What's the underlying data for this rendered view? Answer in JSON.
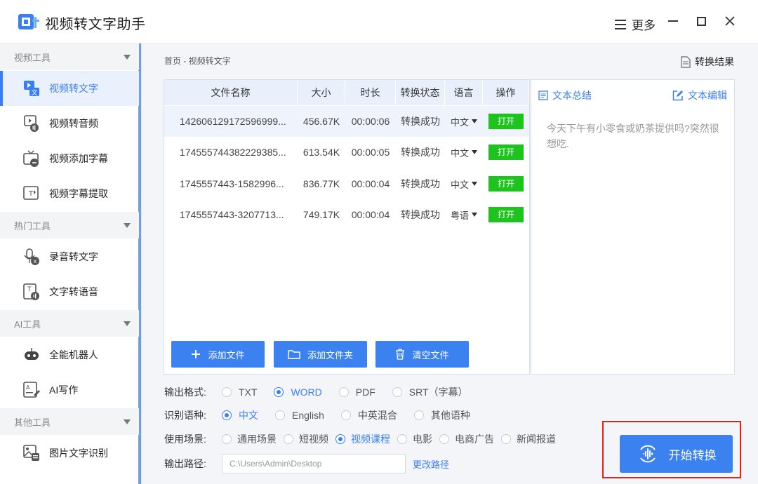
{
  "app": {
    "title": "视频转文字助手",
    "more_label": "更多"
  },
  "colors": {
    "accent": "#3b82f0",
    "success": "#1ec41e",
    "highlight": "#e0241b"
  },
  "sidebar": {
    "groups": [
      {
        "label": "视频工具",
        "items": [
          {
            "label": "视频转文字",
            "icon": "video-to-text-icon",
            "active": true
          },
          {
            "label": "视频转音频",
            "icon": "video-to-audio-icon"
          },
          {
            "label": "视频添加字幕",
            "icon": "add-subtitle-icon"
          },
          {
            "label": "视频字幕提取",
            "icon": "extract-subtitle-icon"
          }
        ]
      },
      {
        "label": "热门工具",
        "items": [
          {
            "label": "录音转文字",
            "icon": "microphone-icon"
          },
          {
            "label": "文字转语音",
            "icon": "text-to-speech-icon"
          }
        ]
      },
      {
        "label": "AI工具",
        "items": [
          {
            "label": "全能机器人",
            "icon": "robot-icon"
          },
          {
            "label": "AI写作",
            "icon": "ai-writing-icon"
          }
        ]
      },
      {
        "label": "其他工具",
        "items": [
          {
            "label": "图片文字识别",
            "icon": "image-ocr-icon"
          }
        ]
      }
    ]
  },
  "breadcrumb": "首页 - 视频转文字",
  "result_link": "转换结果",
  "table": {
    "headers": [
      "文件名称",
      "大小",
      "时长",
      "转换状态",
      "语言",
      "操作"
    ],
    "rows": [
      {
        "name": "142606129172596999...",
        "size": "456.67K",
        "duration": "00:00:06",
        "status": "转换成功",
        "lang": "中文",
        "action": "打开"
      },
      {
        "name": "174555744382229385...",
        "size": "613.54K",
        "duration": "00:00:05",
        "status": "转换成功",
        "lang": "中文",
        "action": "打开"
      },
      {
        "name": "1745557443-1582996...",
        "size": "836.77K",
        "duration": "00:00:04",
        "status": "转换成功",
        "lang": "中文",
        "action": "打开"
      },
      {
        "name": "1745557443-3207713...",
        "size": "749.17K",
        "duration": "00:00:04",
        "status": "转换成功",
        "lang": "粤语",
        "action": "打开"
      }
    ]
  },
  "buttons": {
    "add_file": "添加文件",
    "add_folder": "添加文件夹",
    "clear_files": "清空文件",
    "start": "开始转换"
  },
  "text_panel": {
    "summary": "文本总结",
    "edit": "文本编辑",
    "content": "今天下午有小零食或奶茶提供吗?突然很想吃."
  },
  "options": {
    "format": {
      "label": "输出格式:",
      "choices": [
        "TXT",
        "WORD",
        "PDF",
        "SRT（字幕）"
      ],
      "selected": "WORD"
    },
    "language": {
      "label": "识别语种:",
      "choices": [
        "中文",
        "English",
        "中英混合",
        "其他语种"
      ],
      "selected": "中文"
    },
    "scene": {
      "label": "使用场景:",
      "choices": [
        "通用场景",
        "短视频",
        "视频课程",
        "电影",
        "电商广告",
        "新闻报道"
      ],
      "selected": "视频课程"
    },
    "path": {
      "label": "输出路径:",
      "value": "C:\\Users\\Admin\\Desktop",
      "change": "更改路径"
    }
  }
}
